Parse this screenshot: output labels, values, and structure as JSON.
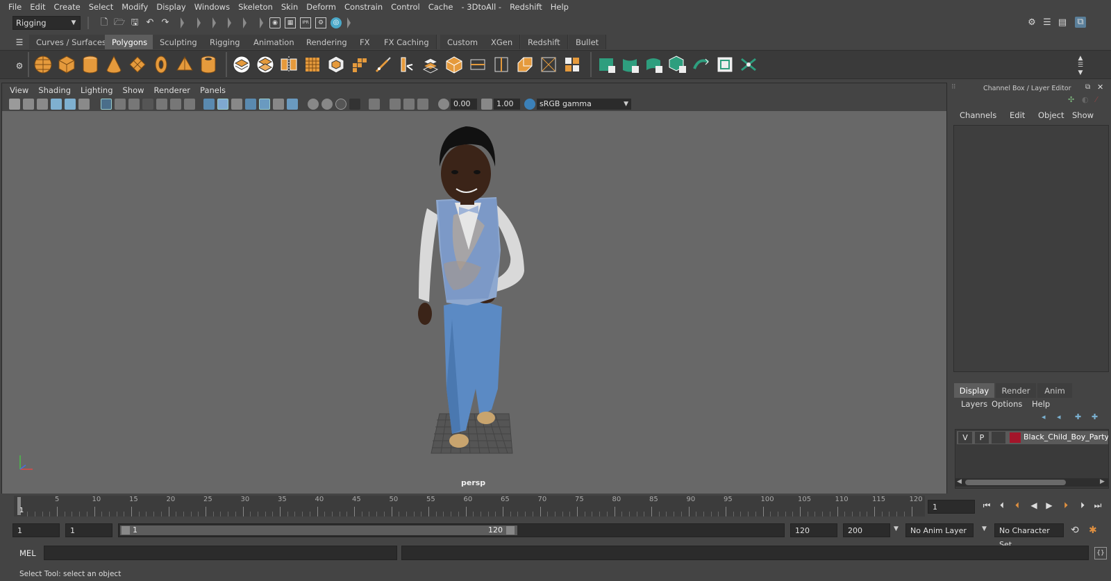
{
  "menubar": {
    "items": [
      "File",
      "Edit",
      "Create",
      "Select",
      "Modify",
      "Display",
      "Windows",
      "Skeleton",
      "Skin",
      "Deform",
      "Constrain",
      "Control",
      "Cache",
      "- 3DtoAll -",
      "Redshift",
      "Help"
    ]
  },
  "statusline": {
    "menuset": "Rigging"
  },
  "shelf": {
    "tabs": [
      "Curves / Surfaces",
      "Polygons",
      "Sculpting",
      "Rigging",
      "Animation",
      "Rendering",
      "FX",
      "FX Caching",
      "Custom",
      "XGen",
      "Redshift",
      "Bullet"
    ],
    "active_tab": "Polygons"
  },
  "viewport": {
    "menu": [
      "View",
      "Shading",
      "Lighting",
      "Show",
      "Renderer",
      "Panels"
    ],
    "exposure": "0.00",
    "gamma": "1.00",
    "colorspace": "sRGB gamma",
    "camera_label": "persp"
  },
  "right_panel": {
    "title": "Channel Box / Layer Editor",
    "channel_menu": [
      "Channels",
      "Edit",
      "Object",
      "Show"
    ],
    "tabs": [
      "Display",
      "Render",
      "Anim"
    ],
    "active_tab": "Display",
    "layer_menu": [
      "Layers",
      "Options",
      "Help"
    ],
    "layer": {
      "visible": "V",
      "playback": "P",
      "color": "#a3152a",
      "name": "Black_Child_Boy_Party_St"
    }
  },
  "timeslider": {
    "first_label": "1",
    "ticks": [
      "5",
      "10",
      "15",
      "20",
      "25",
      "30",
      "35",
      "40",
      "45",
      "50",
      "55",
      "60",
      "65",
      "70",
      "75",
      "80",
      "85",
      "90",
      "95",
      "100",
      "105",
      "110",
      "115",
      "120"
    ],
    "current_frame": "1"
  },
  "rangeslider": {
    "start": "1",
    "playback_start": "1",
    "range_start_label": "1",
    "range_end_label": "120",
    "playback_end": "120",
    "end": "200",
    "anim_layer": "No Anim Layer",
    "character_set": "No Character Set"
  },
  "cmdline": {
    "label": "MEL"
  },
  "helpline": {
    "text": "Select Tool: select an object"
  }
}
